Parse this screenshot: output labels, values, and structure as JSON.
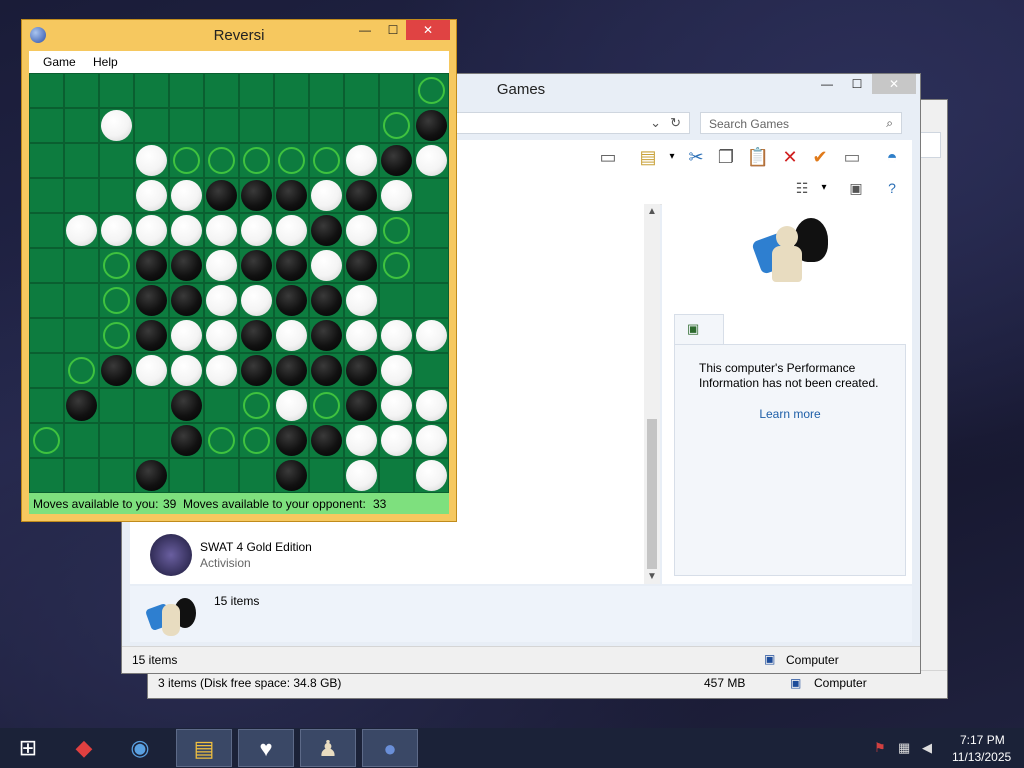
{
  "colors": {
    "board": "#0d7c3f",
    "hint": "#3fc23f",
    "status_bg": "#7ee07e",
    "reversi_frame": "#f6c85f",
    "taskbar": "#1b2238"
  },
  "back_explorer": {
    "status_items": "3 items (Disk free space: 34.8 GB)",
    "status_size": "457 MB",
    "status_location": "Computer"
  },
  "games_explorer": {
    "title": "Games",
    "minimize": "—",
    "maximize": "☐",
    "close": "✕",
    "search_placeholder": "Search Games",
    "game_item": {
      "name": "SWAT 4 Gold Edition",
      "publisher": "Activision"
    },
    "details_count": "15 items",
    "perf_text": "This computer's Performance Information has not been created.",
    "learn_more": "Learn more",
    "status_items": "15 items",
    "status_location": "Computer"
  },
  "reversi": {
    "title": "Reversi",
    "minimize": "—",
    "maximize": "☐",
    "close": "✕",
    "menu": [
      "Game",
      "Help"
    ],
    "board_rows": [
      "...........h",
      "..w.......hb",
      "...whhhhhwbw",
      "...wwbbbwbw.",
      ".wwwwwwwbwh.",
      "..hbbwbbwbh.",
      "..hbbwwbbw..",
      "..hbwwbwbwww",
      ".hbwwwbbbbw.",
      ".b..b.hwhbww",
      "h...bhhbbwwwb",
      "...b...b.w.w"
    ],
    "moves_you_label": "Moves available to you:",
    "moves_you": "39",
    "moves_opp_label": "Moves available to your opponent:",
    "moves_opp": "33"
  },
  "taskbar": {
    "time": "7:17 PM",
    "date": "11/13/2025"
  }
}
